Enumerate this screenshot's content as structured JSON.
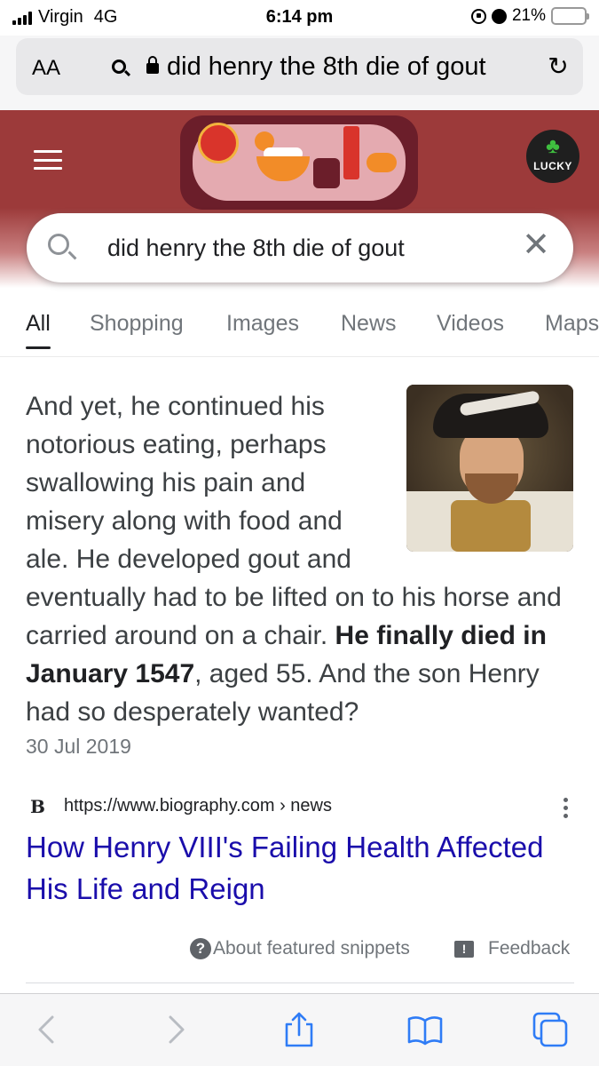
{
  "status_bar": {
    "carrier": "Virgin",
    "network": "4G",
    "time": "6:14 pm",
    "battery_percent": "21%",
    "battery_level": 0.21
  },
  "safari": {
    "aa_label": "AA",
    "url_text": "did henry the 8th die of gout"
  },
  "google": {
    "lucky_label": "LUCKY",
    "query": "did henry the 8th die of gout",
    "tabs": [
      {
        "label": "All",
        "active": true
      },
      {
        "label": "Shopping",
        "active": false
      },
      {
        "label": "Images",
        "active": false
      },
      {
        "label": "News",
        "active": false
      },
      {
        "label": "Videos",
        "active": false
      },
      {
        "label": "Maps",
        "active": false
      }
    ]
  },
  "snippet": {
    "text_before": "And yet, he continued his notorious eating, perhaps swallowing his pain and misery along with food and ale. He developed gout and eventually had to be lifted on to his horse and carried around on a chair. ",
    "text_bold": "He finally died in January 1547",
    "text_after": ", aged 55. And the son Henry had so desperately wanted?",
    "date": "30 Jul 2019"
  },
  "result": {
    "favicon_letter": "B",
    "url": "https://www.biography.com › news",
    "title": "How Henry VIII's Failing Health Affected His Life and Reign"
  },
  "footer": {
    "about_label": "About featured snippets",
    "feedback_label": "Feedback"
  },
  "colors": {
    "header_red": "#9c3a3a",
    "link_blue": "#1a0dab",
    "safari_blue": "#2f7cf6"
  }
}
